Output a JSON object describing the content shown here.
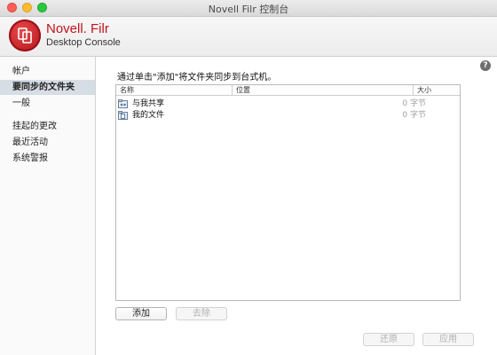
{
  "window": {
    "title": "Novell Filr 控制台"
  },
  "brand": {
    "name": "Novell. Filr",
    "subtitle": "Desktop Console"
  },
  "sidebar": {
    "items": [
      {
        "label": "帐户",
        "selected": false
      },
      {
        "label": "要同步的文件夹",
        "selected": true
      },
      {
        "label": "一般",
        "selected": false
      },
      {
        "label": "挂起的更改",
        "selected": false
      },
      {
        "label": "最近活动",
        "selected": false
      },
      {
        "label": "系统警报",
        "selected": false
      }
    ]
  },
  "help": {
    "label": "?"
  },
  "main": {
    "instruction": "通过单击\"添加\"将文件夹同步到台式机。",
    "table": {
      "columns": [
        "名称",
        "位置",
        "大小"
      ],
      "rows": [
        {
          "name": "与我共享",
          "location": "",
          "size": "0 字节",
          "icon": "shared-folder-icon"
        },
        {
          "name": "我的文件",
          "location": "",
          "size": "0 字节",
          "icon": "my-files-folder-icon"
        }
      ]
    },
    "add_button": "添加",
    "remove_button": "去除"
  },
  "footer": {
    "revert_button": "还原",
    "apply_button": "应用"
  },
  "colors": {
    "brand": "#c4131b",
    "selection": "#d7dde5"
  }
}
